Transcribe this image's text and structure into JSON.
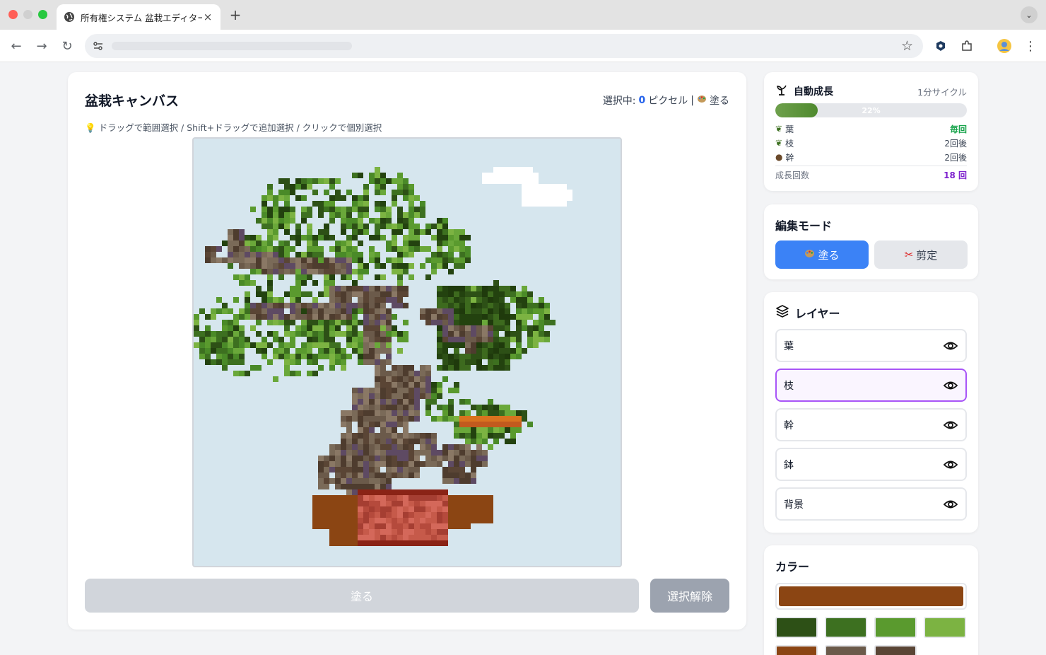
{
  "browser": {
    "tab_title": "所有権システム 盆栽エディター",
    "new_tab": "+",
    "tab_close": "×"
  },
  "canvas": {
    "title": "盆栽キャンバス",
    "selection_label": "選択中:",
    "selection_count": "0",
    "selection_unit": "ピクセル",
    "separator": "|",
    "mode_label": "塗る",
    "hint": "ドラッグで範囲選択 / Shift+ドラッグで追加選択 / クリックで個別選択",
    "paint_button": "塗る",
    "clear_button": "選択解除"
  },
  "growth": {
    "title": "自動成長",
    "cycle": "1分サイクル",
    "progress_text": "22%",
    "progress": 0.22,
    "rows": [
      {
        "label": "葉",
        "value": "毎回",
        "value_color": "#16a34a"
      },
      {
        "label": "枝",
        "value": "2回後",
        "value_color": "#374151"
      },
      {
        "label": "幹",
        "value": "2回後",
        "value_color": "#374151"
      }
    ],
    "count_label": "成長回数",
    "count_value": "18",
    "count_unit": "回",
    "count_color": "#7e22ce"
  },
  "mode": {
    "title": "編集モード",
    "paint_label": "塗る",
    "prune_label": "剪定",
    "active_color": "#3b82f6"
  },
  "layers": {
    "title": "レイヤー",
    "items": [
      {
        "label": "葉",
        "active": false
      },
      {
        "label": "枝",
        "active": true
      },
      {
        "label": "幹",
        "active": false
      },
      {
        "label": "鉢",
        "active": false
      },
      {
        "label": "背景",
        "active": false
      }
    ]
  },
  "colors": {
    "title": "カラー",
    "current": "#8b4513",
    "swatches": [
      "#2d5016",
      "#3d7020",
      "#5a9a2e",
      "#7cb342",
      "#8b4513",
      "#6b5a4a",
      "#5a4535"
    ]
  }
}
